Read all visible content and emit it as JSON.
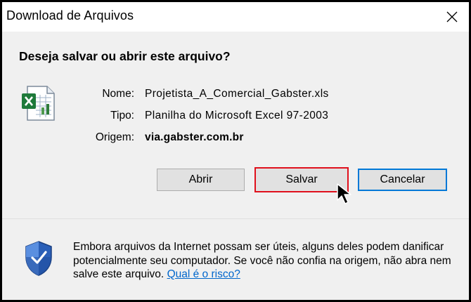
{
  "window": {
    "title": "Download de Arquivos",
    "close_glyph": "✕"
  },
  "dialog": {
    "question": "Deseja salvar ou abrir este arquivo?",
    "file_icon": "excel-file-icon",
    "fields": [
      {
        "label": "Nome:",
        "value": "Projetista_A_Comercial_Gabster.xls"
      },
      {
        "label": "Tipo:",
        "value": "Planilha do Microsoft Excel 97-2003"
      },
      {
        "label": "Origem:",
        "value": "via.gabster.com.br"
      }
    ]
  },
  "buttons": {
    "open_label": "Abrir",
    "save_label": "Salvar",
    "cancel_label": "Cancelar"
  },
  "footer": {
    "warning_text": "Embora arquivos da Internet possam ser úteis, alguns deles podem danificar potencialmente seu computador. Se você não confia na origem, não abra nem salve este arquivo.",
    "risk_link": "Qual é o risco?"
  },
  "colors": {
    "highlight_border": "#e0101c",
    "default_button_border": "#0078d7",
    "link": "#0066cc"
  }
}
